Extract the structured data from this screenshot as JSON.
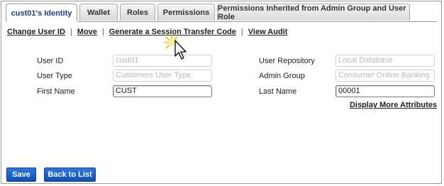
{
  "tabs": [
    {
      "label": "cust01's Identity",
      "active": true
    },
    {
      "label": "Wallet",
      "active": false
    },
    {
      "label": "Roles",
      "active": false
    },
    {
      "label": "Permissions",
      "active": false
    },
    {
      "label": "Permissions Inherited from Admin Group and User Role",
      "active": false
    }
  ],
  "actions": {
    "change_user_id": "Change User ID",
    "move": "Move",
    "generate_code": "Generate a Session Transfer Code",
    "view_audit": "View Audit",
    "separator": "|"
  },
  "form": {
    "user_id": {
      "label": "User ID",
      "placeholder": "cust01"
    },
    "user_type": {
      "label": "User Type",
      "placeholder": "Customers User Type"
    },
    "first_name": {
      "label": "First Name",
      "value": "CUST"
    },
    "user_repository": {
      "label": "User Repository",
      "placeholder": "Local Database"
    },
    "admin_group": {
      "label": "Admin Group",
      "placeholder": "Consumer Online Banking"
    },
    "last_name": {
      "label": "Last Name",
      "value": "00001"
    }
  },
  "display_more": "Display More Attributes",
  "buttons": {
    "save": "Save",
    "back": "Back to List"
  },
  "colors": {
    "button_blue": "#1560d0",
    "active_tab_text": "#1a3d8f"
  }
}
